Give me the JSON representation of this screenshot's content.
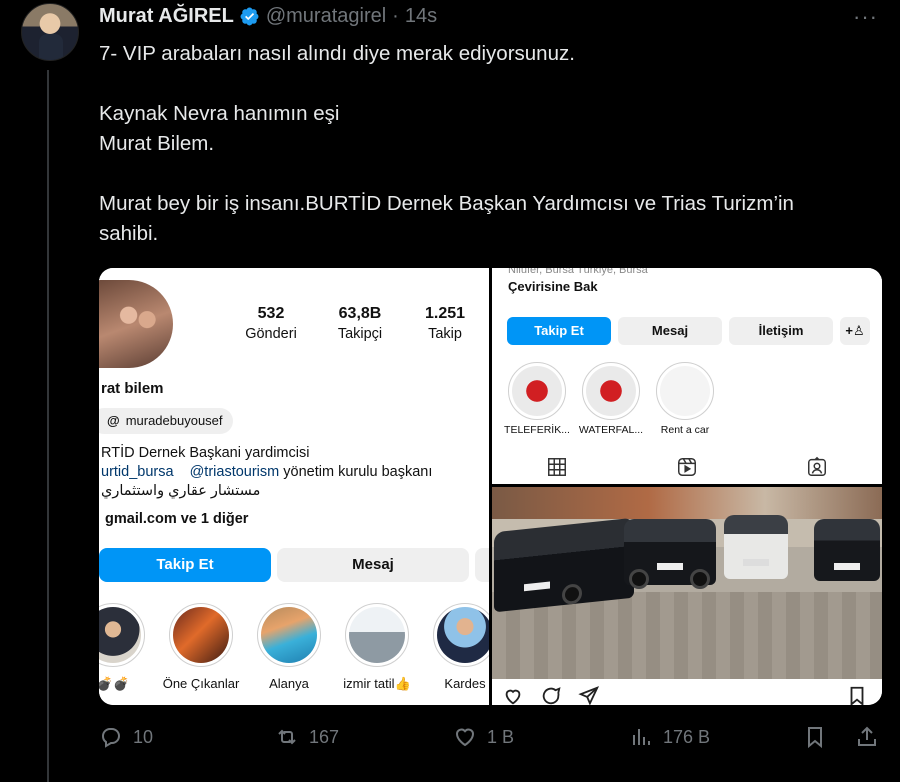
{
  "author": {
    "name": "Murat AĞIREL",
    "handle": "@muratagirel",
    "separator": "·",
    "time": "14s"
  },
  "tweet": {
    "line1": "7- VIP arabaları nasıl alındı diye merak ediyorsunuz.",
    "line2": "Kaynak Nevra hanımın eşi",
    "line3": "Murat Bilem.",
    "line4": "Murat bey bir iş insanı.BURTİD Dernek Başkan Yardımcısı ve Trias Turizm’in",
    "line5": "sahibi."
  },
  "more_label": "···",
  "instagram_left": {
    "stats": [
      {
        "num": "532",
        "label": "Gönderi"
      },
      {
        "num": "63,8B",
        "label": "Takipçi"
      },
      {
        "num": "1.251",
        "label": "Takip"
      }
    ],
    "name": "rat bilem",
    "threads_handle": "muradebuyousef",
    "bio1": "RTİD Dernek Başkani yardimcisi",
    "bio2_a": "urtid_bursa",
    "bio2_b": "@triastourism",
    "bio2_c": " yönetim kurulu başkanı",
    "bio3": "مستشار عقاري واستثماري",
    "link": "gmail.com ve 1 diğer",
    "follow": "Takip Et",
    "message": "Mesaj",
    "highlights": [
      "💣💣",
      "Öne Çıkanlar",
      "Alanya",
      "izmir tatil👍",
      "Kardes"
    ]
  },
  "instagram_right": {
    "location": "Nilüfer, Bursa Türkiye, Bursa",
    "translate": "Çevirisine Bak",
    "follow": "Takip Et",
    "message": "Mesaj",
    "contact": "İletişim",
    "highlights": [
      "TELEFERİK...",
      "WATERFAL...",
      "Rent a car"
    ]
  },
  "actions": {
    "replies": "10",
    "retweets": "167",
    "likes": "1 B",
    "views": "176 B"
  },
  "colors": {
    "background": "#000000",
    "text": "#e7e9ea",
    "muted": "#71767b",
    "verified": "#1d9bf0",
    "ig_blue": "#0095f6"
  }
}
